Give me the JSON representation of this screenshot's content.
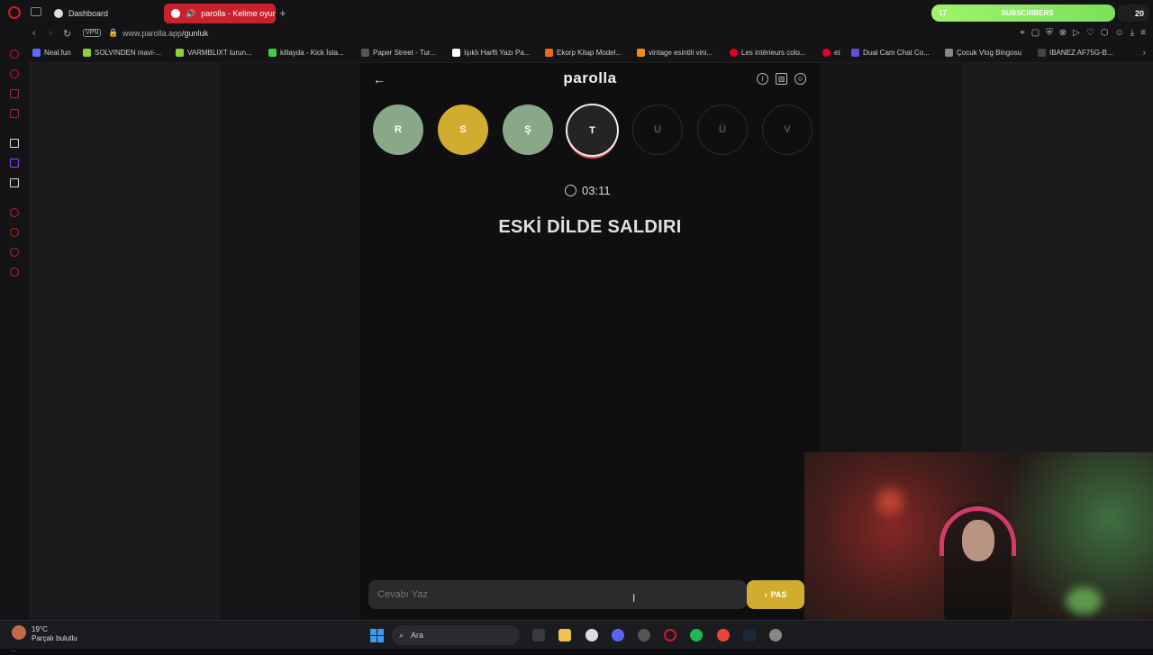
{
  "browser": {
    "tabs": [
      {
        "label": "Dashboard"
      },
      {
        "label": "parolla - Kelime oyunu"
      }
    ],
    "address": {
      "vpn": "VPN",
      "domain": "www.parolla.app",
      "path": "/gunluk"
    },
    "bookmarks": [
      {
        "label": "Neal.fun",
        "color": "#5b6bff"
      },
      {
        "label": "SOLVINDEN mavi-...",
        "color": "#8fcf3b"
      },
      {
        "label": "VARMBLIXT turun...",
        "color": "#8fcf3b"
      },
      {
        "label": "killayda - Kick İsta...",
        "color": "#3fd13f"
      },
      {
        "label": "Paper Street - Tur...",
        "color": "#555555"
      },
      {
        "label": "Işıklı Harfli Yazı Pa...",
        "color": "#ffffff"
      },
      {
        "label": "Ekorp Kitap Model...",
        "color": "#f06a1a"
      },
      {
        "label": "vintage esintili vini...",
        "color": "#f08a1a"
      },
      {
        "label": "Les intérieurs colo...",
        "color": "#e60023"
      },
      {
        "label": "et",
        "color": "#e60023"
      },
      {
        "label": "Dual Cam Chat Co...",
        "color": "#6a4ad8"
      },
      {
        "label": "Çocuk Vlog Bingosu",
        "color": "#888888"
      },
      {
        "label": "IBANEZ AF75G-B...",
        "color": "#444444"
      }
    ]
  },
  "overlay": {
    "subscribers_label": "SUBSCRIBERS",
    "subscribers_current": "17",
    "subscribers_goal": "20"
  },
  "game": {
    "logo": "parolla",
    "letters": [
      {
        "letter": "R",
        "state": "correct"
      },
      {
        "letter": "S",
        "state": "passed"
      },
      {
        "letter": "Ş",
        "state": "correct"
      },
      {
        "letter": "T",
        "state": "current"
      },
      {
        "letter": "U",
        "state": "pending"
      },
      {
        "letter": "Ü",
        "state": "pending"
      },
      {
        "letter": "V",
        "state": "pending"
      }
    ],
    "timer": "03:11",
    "question": "ESKİ DİLDE SALDIRI",
    "answer_placeholder": "Cevabı Yaz",
    "pass_label": "PAS",
    "colors": {
      "correct": "#88a888",
      "passed": "#d1ac2f",
      "current_ring": "#e44c56"
    }
  },
  "taskbar": {
    "weather_temp": "19°C",
    "weather_desc": "Parçalı bulutlu",
    "search_label": "Ara"
  }
}
